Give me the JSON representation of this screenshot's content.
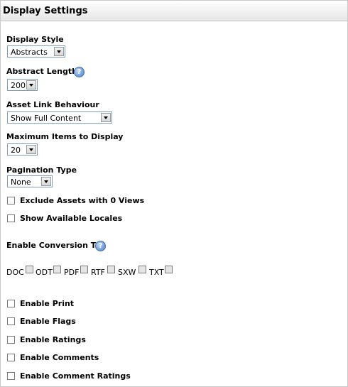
{
  "header": {
    "title": "Display Settings"
  },
  "display_style": {
    "label": "Display Style",
    "selected": "Abstracts"
  },
  "abstract_length": {
    "label": "Abstract Length",
    "selected": "200",
    "help_icon": "help-icon"
  },
  "asset_link_behaviour": {
    "label": "Asset Link Behaviour",
    "selected": "Show Full Content"
  },
  "max_items": {
    "label": "Maximum Items to Display",
    "selected": "20"
  },
  "pagination_type": {
    "label": "Pagination Type",
    "selected": "None"
  },
  "checkboxes_top": [
    {
      "label": "Exclude Assets with 0 Views",
      "checked": false
    },
    {
      "label": "Show Available Locales",
      "checked": false
    }
  ],
  "enable_conversion": {
    "label": "Enable Conversion To",
    "formats": [
      "DOC",
      "ODT",
      "PDF",
      "RTF",
      "SXW",
      "TXT"
    ]
  },
  "checkboxes_bottom": [
    {
      "label": "Enable Print",
      "checked": false
    },
    {
      "label": "Enable Flags",
      "checked": false
    },
    {
      "label": "Enable Ratings",
      "checked": false
    },
    {
      "label": "Enable Comments",
      "checked": false
    },
    {
      "label": "Enable Comment Ratings",
      "checked": false
    }
  ],
  "colors": {
    "header_bg": "#e6e6e6",
    "border": "#c9c9c9",
    "select_border": "#7f9db9",
    "help_icon": "#4a7fc6"
  }
}
